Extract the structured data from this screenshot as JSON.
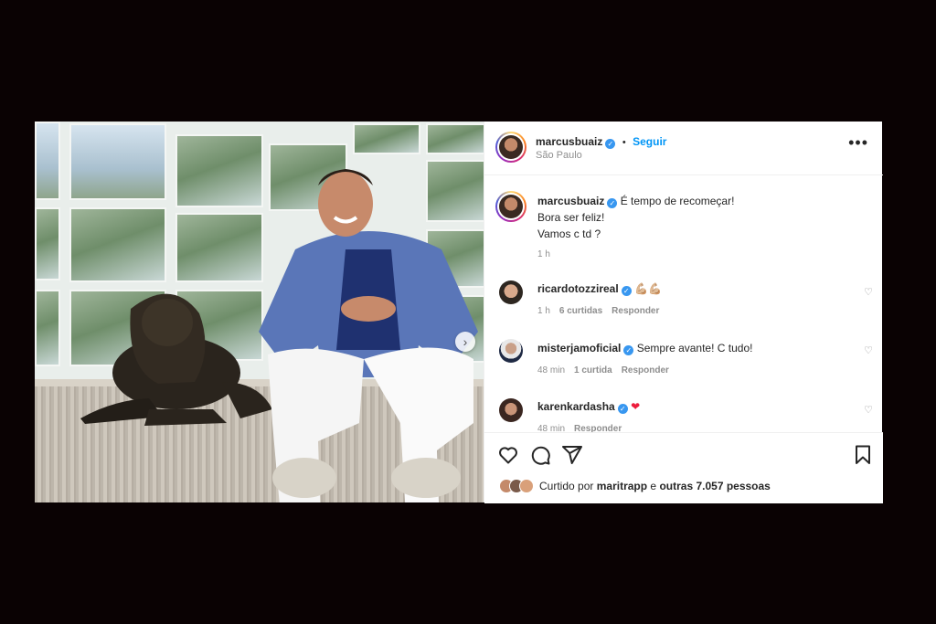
{
  "post": {
    "author": {
      "username": "marcusbuaiz",
      "verified_mark": "✓",
      "follow_label": "Seguir",
      "separator": "•",
      "location": "São Paulo",
      "more_label": "•••"
    },
    "caption": {
      "username": "marcusbuaiz",
      "line1": "É tempo de recomeçar!",
      "line2": "Bora ser feliz!",
      "line3": "Vamos c td ?",
      "time": "1 h"
    },
    "comments": [
      {
        "username": "ricardotozzireal",
        "text": "💪🏼💪🏼",
        "time": "1 h",
        "likes": "6 curtidas",
        "reply": "Responder"
      },
      {
        "username": "misterjamoficial",
        "text": "Sempre avante! C tudo!",
        "time": "48 min",
        "likes": "1 curtida",
        "reply": "Responder"
      },
      {
        "username": "karenkardasha",
        "text": "❤",
        "time": "48 min",
        "likes": "",
        "reply": "Responder"
      }
    ],
    "likes_summary": {
      "prefix": "Curtido por",
      "user": "maritrapp",
      "middle": "e",
      "rest": "outras 7.057 pessoas"
    },
    "icons": {
      "like": "heart-icon",
      "comment": "comment-icon",
      "share": "paper-plane-icon",
      "save": "bookmark-icon",
      "next": "chevron-right-icon"
    },
    "colors": {
      "background": "#0a0203",
      "accent": "#0095f6",
      "verified": "#3897f0"
    }
  }
}
